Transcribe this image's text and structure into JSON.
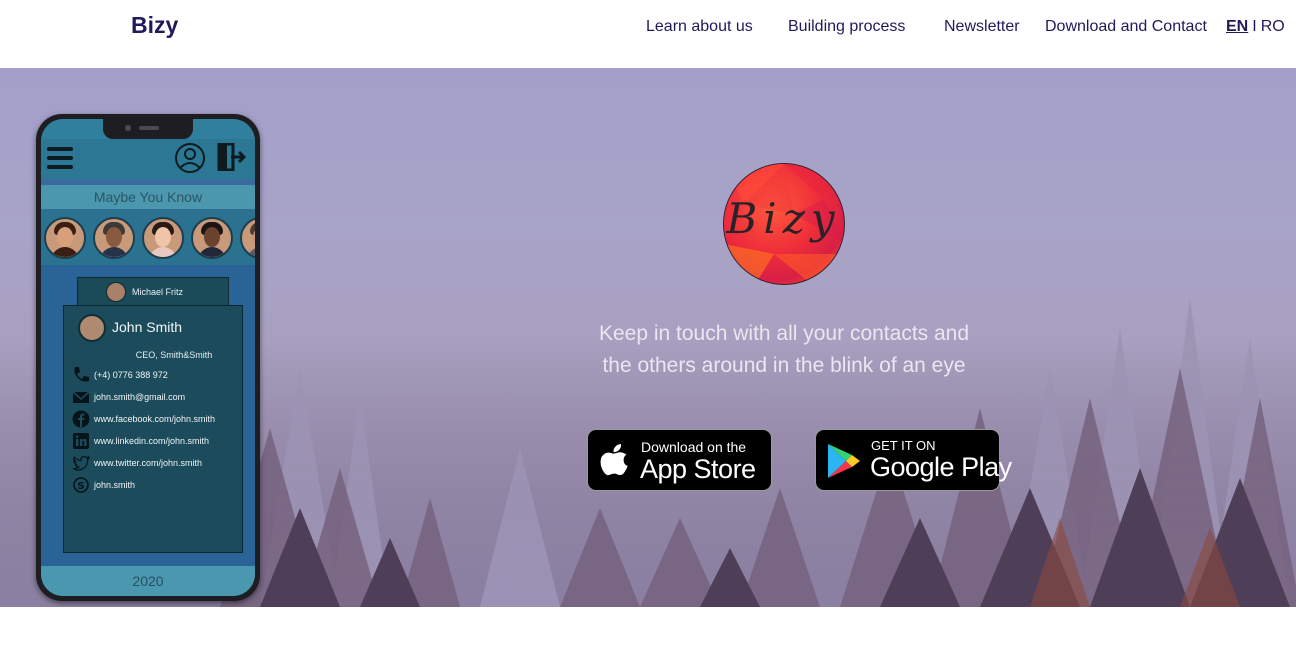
{
  "header": {
    "brand": "Bizy",
    "nav": [
      "Learn about us",
      "Building process",
      "Newsletter",
      "Download and Contact"
    ],
    "lang": {
      "active": "EN",
      "separator": "I",
      "other": "RO"
    }
  },
  "hero": {
    "logo_text": "Bizy",
    "tagline_line1": "Keep in touch with all your contacts and",
    "tagline_line2": "the others around in the blink of an eye",
    "app_store": {
      "small": "Download on the",
      "big": "App Store",
      "icon": "apple-icon"
    },
    "google_play": {
      "small": "GET IT ON",
      "big": "Google Play",
      "icon": "google-play-icon"
    }
  },
  "phone": {
    "section_label": "Maybe You Know",
    "mini_card_name": "Michael Fritz",
    "card": {
      "name": "John Smith",
      "title": "CEO, Smith&Smith",
      "phone": "(+4) 0776 388 972",
      "email": "john.smith@gmail.com",
      "facebook": "www.facebook.com/john.smith",
      "linkedin": "www.linkedin.com/john.smith",
      "twitter": "www.twitter.com/john.smith",
      "skype": "john.smith"
    },
    "year": "2020"
  },
  "colors": {
    "brand_text": "#1f1b5a",
    "phone_screen": "#2f7f9d",
    "card_bg": "#1c4c5b"
  }
}
